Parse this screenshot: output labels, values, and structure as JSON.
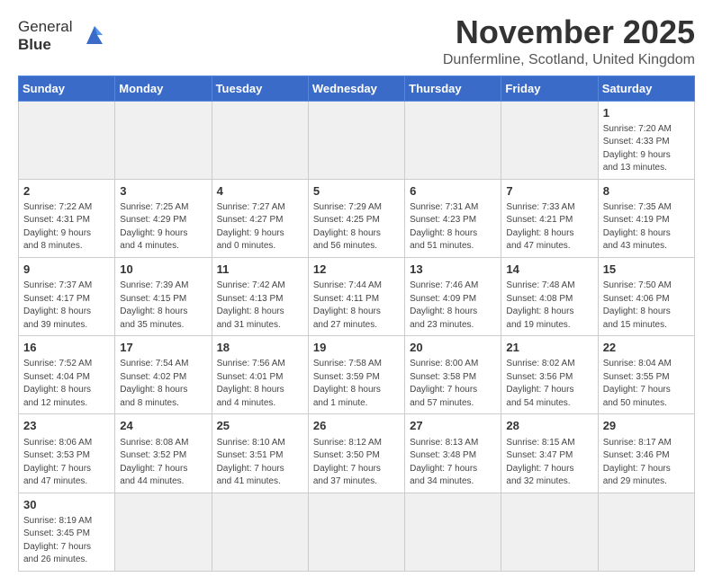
{
  "logo": {
    "line1": "General",
    "line2": "Blue"
  },
  "header": {
    "title": "November 2025",
    "location": "Dunfermline, Scotland, United Kingdom"
  },
  "weekdays": [
    "Sunday",
    "Monday",
    "Tuesday",
    "Wednesday",
    "Thursday",
    "Friday",
    "Saturday"
  ],
  "weeks": [
    [
      {
        "day": "",
        "info": ""
      },
      {
        "day": "",
        "info": ""
      },
      {
        "day": "",
        "info": ""
      },
      {
        "day": "",
        "info": ""
      },
      {
        "day": "",
        "info": ""
      },
      {
        "day": "",
        "info": ""
      },
      {
        "day": "1",
        "info": "Sunrise: 7:20 AM\nSunset: 4:33 PM\nDaylight: 9 hours\nand 13 minutes."
      }
    ],
    [
      {
        "day": "2",
        "info": "Sunrise: 7:22 AM\nSunset: 4:31 PM\nDaylight: 9 hours\nand 8 minutes."
      },
      {
        "day": "3",
        "info": "Sunrise: 7:25 AM\nSunset: 4:29 PM\nDaylight: 9 hours\nand 4 minutes."
      },
      {
        "day": "4",
        "info": "Sunrise: 7:27 AM\nSunset: 4:27 PM\nDaylight: 9 hours\nand 0 minutes."
      },
      {
        "day": "5",
        "info": "Sunrise: 7:29 AM\nSunset: 4:25 PM\nDaylight: 8 hours\nand 56 minutes."
      },
      {
        "day": "6",
        "info": "Sunrise: 7:31 AM\nSunset: 4:23 PM\nDaylight: 8 hours\nand 51 minutes."
      },
      {
        "day": "7",
        "info": "Sunrise: 7:33 AM\nSunset: 4:21 PM\nDaylight: 8 hours\nand 47 minutes."
      },
      {
        "day": "8",
        "info": "Sunrise: 7:35 AM\nSunset: 4:19 PM\nDaylight: 8 hours\nand 43 minutes."
      }
    ],
    [
      {
        "day": "9",
        "info": "Sunrise: 7:37 AM\nSunset: 4:17 PM\nDaylight: 8 hours\nand 39 minutes."
      },
      {
        "day": "10",
        "info": "Sunrise: 7:39 AM\nSunset: 4:15 PM\nDaylight: 8 hours\nand 35 minutes."
      },
      {
        "day": "11",
        "info": "Sunrise: 7:42 AM\nSunset: 4:13 PM\nDaylight: 8 hours\nand 31 minutes."
      },
      {
        "day": "12",
        "info": "Sunrise: 7:44 AM\nSunset: 4:11 PM\nDaylight: 8 hours\nand 27 minutes."
      },
      {
        "day": "13",
        "info": "Sunrise: 7:46 AM\nSunset: 4:09 PM\nDaylight: 8 hours\nand 23 minutes."
      },
      {
        "day": "14",
        "info": "Sunrise: 7:48 AM\nSunset: 4:08 PM\nDaylight: 8 hours\nand 19 minutes."
      },
      {
        "day": "15",
        "info": "Sunrise: 7:50 AM\nSunset: 4:06 PM\nDaylight: 8 hours\nand 15 minutes."
      }
    ],
    [
      {
        "day": "16",
        "info": "Sunrise: 7:52 AM\nSunset: 4:04 PM\nDaylight: 8 hours\nand 12 minutes."
      },
      {
        "day": "17",
        "info": "Sunrise: 7:54 AM\nSunset: 4:02 PM\nDaylight: 8 hours\nand 8 minutes."
      },
      {
        "day": "18",
        "info": "Sunrise: 7:56 AM\nSunset: 4:01 PM\nDaylight: 8 hours\nand 4 minutes."
      },
      {
        "day": "19",
        "info": "Sunrise: 7:58 AM\nSunset: 3:59 PM\nDaylight: 8 hours\nand 1 minute."
      },
      {
        "day": "20",
        "info": "Sunrise: 8:00 AM\nSunset: 3:58 PM\nDaylight: 7 hours\nand 57 minutes."
      },
      {
        "day": "21",
        "info": "Sunrise: 8:02 AM\nSunset: 3:56 PM\nDaylight: 7 hours\nand 54 minutes."
      },
      {
        "day": "22",
        "info": "Sunrise: 8:04 AM\nSunset: 3:55 PM\nDaylight: 7 hours\nand 50 minutes."
      }
    ],
    [
      {
        "day": "23",
        "info": "Sunrise: 8:06 AM\nSunset: 3:53 PM\nDaylight: 7 hours\nand 47 minutes."
      },
      {
        "day": "24",
        "info": "Sunrise: 8:08 AM\nSunset: 3:52 PM\nDaylight: 7 hours\nand 44 minutes."
      },
      {
        "day": "25",
        "info": "Sunrise: 8:10 AM\nSunset: 3:51 PM\nDaylight: 7 hours\nand 41 minutes."
      },
      {
        "day": "26",
        "info": "Sunrise: 8:12 AM\nSunset: 3:50 PM\nDaylight: 7 hours\nand 37 minutes."
      },
      {
        "day": "27",
        "info": "Sunrise: 8:13 AM\nSunset: 3:48 PM\nDaylight: 7 hours\nand 34 minutes."
      },
      {
        "day": "28",
        "info": "Sunrise: 8:15 AM\nSunset: 3:47 PM\nDaylight: 7 hours\nand 32 minutes."
      },
      {
        "day": "29",
        "info": "Sunrise: 8:17 AM\nSunset: 3:46 PM\nDaylight: 7 hours\nand 29 minutes."
      }
    ],
    [
      {
        "day": "30",
        "info": "Sunrise: 8:19 AM\nSunset: 3:45 PM\nDaylight: 7 hours\nand 26 minutes."
      },
      {
        "day": "",
        "info": ""
      },
      {
        "day": "",
        "info": ""
      },
      {
        "day": "",
        "info": ""
      },
      {
        "day": "",
        "info": ""
      },
      {
        "day": "",
        "info": ""
      },
      {
        "day": "",
        "info": ""
      }
    ]
  ]
}
